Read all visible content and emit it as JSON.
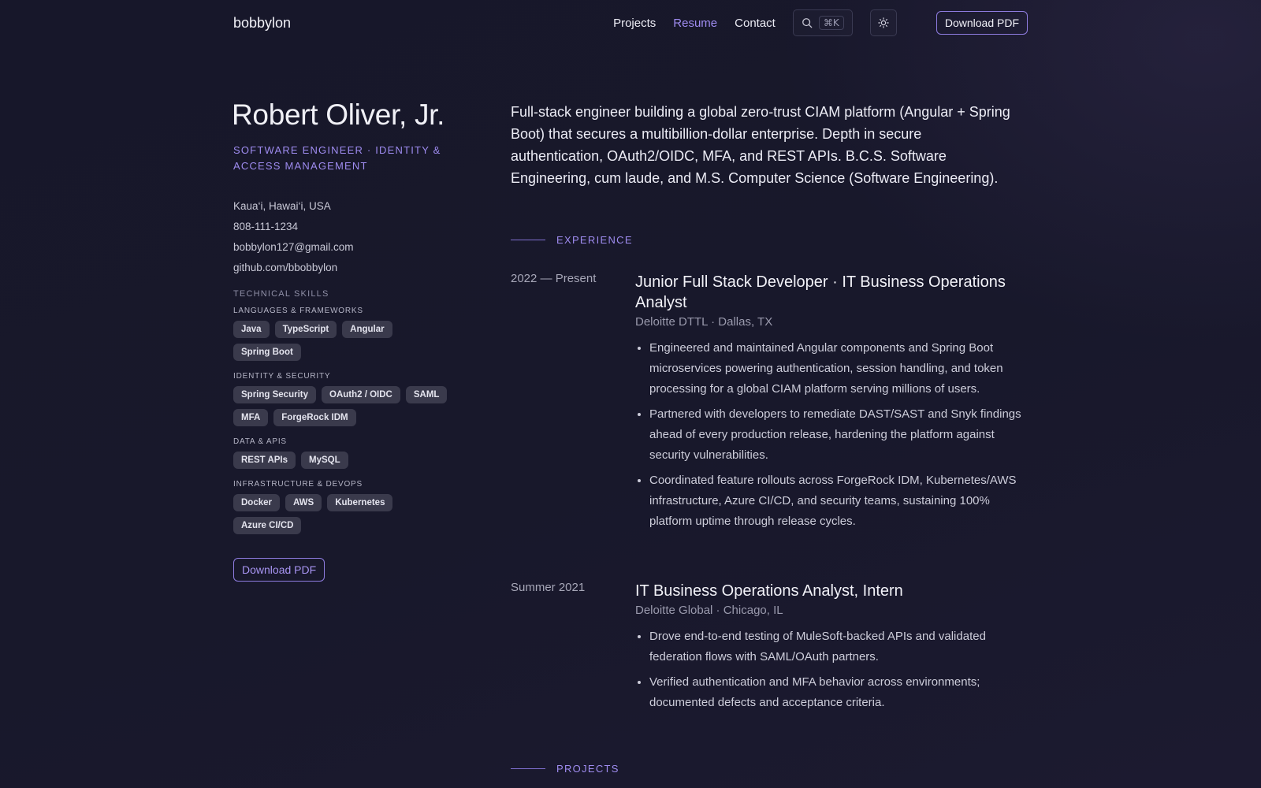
{
  "header": {
    "brand": "bobbylon",
    "nav": [
      {
        "label": "Projects",
        "active": false
      },
      {
        "label": "Resume",
        "active": true
      },
      {
        "label": "Contact",
        "active": false
      }
    ],
    "search_shortcut": "⌘K",
    "download_label": "Download PDF",
    "accent": "#9f8cf0"
  },
  "profile": {
    "name": "Robert Oliver, Jr.",
    "role": "SOFTWARE ENGINEER · IDENTITY & ACCESS MANAGEMENT",
    "contact": [
      "Kaua‘i, Hawai‘i, USA",
      "808-111-1234",
      "bobbylon127@gmail.com",
      "github.com/bbobbylon"
    ]
  },
  "skills": {
    "title": "TECHNICAL SKILLS",
    "groups": [
      {
        "title": "LANGUAGES & FRAMEWORKS",
        "items": [
          "Java",
          "TypeScript",
          "Angular",
          "Spring Boot"
        ]
      },
      {
        "title": "IDENTITY & SECURITY",
        "items": [
          "Spring Security",
          "OAuth2 / OIDC",
          "SAML",
          "MFA",
          "ForgeRock IDM"
        ]
      },
      {
        "title": "DATA & APIS",
        "items": [
          "REST APIs",
          "MySQL"
        ]
      },
      {
        "title": "INFRASTRUCTURE & DEVOPS",
        "items": [
          "Docker",
          "AWS",
          "Kubernetes",
          "Azure CI/CD"
        ]
      }
    ]
  },
  "left_download_label": "Download PDF",
  "summary": "Full-stack engineer building a global zero-trust CIAM platform (Angular + Spring Boot) that secures a multibillion-dollar enterprise. Depth in secure authentication, OAuth2/OIDC, MFA, and REST APIs. B.C.S. Software Engineering, cum laude, and M.S. Computer Science (Software Engineering).",
  "experience": {
    "label": "EXPERIENCE",
    "jobs": [
      {
        "dates": "2022 — Present",
        "title": "Junior Full Stack Developer · IT Business Operations Analyst",
        "company": "Deloitte DTTL · Dallas, TX",
        "bullets": [
          "Engineered and maintained Angular components and Spring Boot microservices powering authentication, session handling, and token processing for a global CIAM platform serving millions of users.",
          "Partnered with developers to remediate DAST/SAST and Snyk findings ahead of every production release, hardening the platform against security vulnerabilities.",
          "Coordinated feature rollouts across ForgeRock IDM, Kubernetes/AWS infrastructure, Azure CI/CD, and security teams, sustaining 100% platform uptime through release cycles."
        ]
      },
      {
        "dates": "Summer 2021",
        "title": "IT Business Operations Analyst, Intern",
        "company": "Deloitte Global · Chicago, IL",
        "bullets": [
          "Drove end-to-end testing of MuleSoft-backed APIs and validated federation flows with SAML/OAuth partners.",
          "Verified authentication and MFA behavior across environments; documented defects and acceptance criteria."
        ]
      }
    ]
  },
  "projects": {
    "label": "PROJECTS"
  }
}
